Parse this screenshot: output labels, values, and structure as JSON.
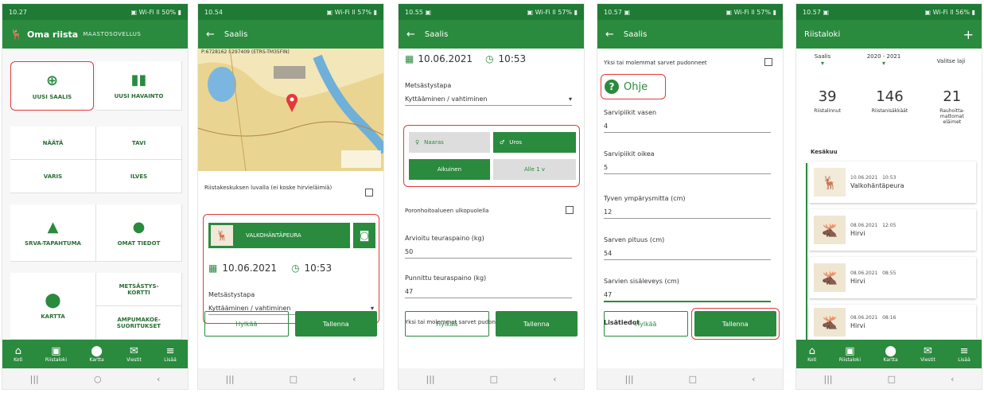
{
  "statusbar": {
    "p1": {
      "time": "10.27",
      "right": "▣ Wi-Fi ll 50% ▮"
    },
    "p2": {
      "time": "10.54",
      "right": "▣ Wi-Fi ll 57% ▮"
    },
    "p3": {
      "time": "10.55 ▣",
      "right": "▣ Wi-Fi ll 57% ▮"
    },
    "p4": {
      "time": "10.57 ▣",
      "right": "▣ Wi-Fi ll 57% ▮"
    },
    "p5": {
      "time": "10.57 ▣",
      "right": "▣ Wi-Fi ll 56% ▮"
    }
  },
  "home": {
    "brand": "Oma riista",
    "subtitle": "MAASTOSOVELLUS",
    "tiles": {
      "new_catch": "UUSI SAALIS",
      "new_observation": "UUSI HAVAINTO",
      "nayta": "NÄÄTÄ",
      "tavi": "TAVI",
      "varis": "VARIS",
      "ilves": "ILVES",
      "srva": "SRVA-TAPAHTUMA",
      "own_info": "OMAT TIEDOT",
      "license": "METSÄSTYS-KORTTI",
      "map": "KARTTA",
      "shooting": "AMPUMAKOE-SUORITUKSET"
    }
  },
  "nav": {
    "home": "Koti",
    "diary": "Riistaloki",
    "map": "Kartta",
    "messages": "Viestit",
    "more": "Lisää"
  },
  "catch_title": "Saalis",
  "p2": {
    "map_coords": "P:6728162 I:297409 (ETRS-TM35FIN)",
    "permit_check": "Riistakeskuksen luvalla (ei koske hirvieläimiä)",
    "species": "VALKOHÄNTÄPEURA",
    "date": "10.06.2021",
    "time": "10:53",
    "method_label": "Metsästystapa",
    "method_value": "Kyttääminen / vahtiminen",
    "reject": "Hylkää",
    "save": "Tallenna"
  },
  "p3": {
    "date": "10.06.2021",
    "time": "10:53",
    "method_label": "Metsästystapa",
    "method_value": "Kyttääminen / vahtiminen",
    "female": "Naaras",
    "male": "Uros",
    "adult": "Aikuinen",
    "young": "Alle 1 v",
    "non_edible": "Poronhoitoalueen ulkopuolella",
    "est_weight_label": "Arvioitu teuraspaino (kg)",
    "est_weight": "50",
    "measured_weight_label": "Punnittu teuraspaino (kg)",
    "measured_weight": "47",
    "antlers_lost": "Yksi tai molemmat sarvet pudonneet",
    "reject": "Hylkää",
    "save": "Tallenna"
  },
  "p4": {
    "antlers_lost": "Yksi tai molemmat sarvet pudonneet",
    "help": "Ohje",
    "left_points_label": "Sarvipiikit vasen",
    "left_points": "4",
    "right_points_label": "Sarvipiikit oikea",
    "right_points": "5",
    "circ_label": "Tyven ympärysmitta (cm)",
    "circ": "12",
    "length_label": "Sarven pituus (cm)",
    "length": "54",
    "width_label": "Sarvien sisäleveys (cm)",
    "width": "47",
    "extra_label": "Lisätiedot",
    "reject": "Hylkää",
    "save": "Tallenna"
  },
  "p5": {
    "title": "Riistaloki",
    "add": "+",
    "filter_type": "Saalis",
    "filter_season": "2020 - 2021",
    "filter_species": "Valitse laji",
    "stats": [
      {
        "value": "39",
        "label": "Riistalinnut"
      },
      {
        "value": "146",
        "label": "Riistanisäkkäät"
      },
      {
        "value": "21",
        "label": "Rauhoitta-mattomat eläimet"
      }
    ],
    "month": "Kesäkuu",
    "entries": [
      {
        "date": "10.06.2021",
        "time": "10:53",
        "species": "Valkohäntäpeura"
      },
      {
        "date": "08.06.2021",
        "time": "12:05",
        "species": "Hirvi"
      },
      {
        "date": "08.06.2021",
        "time": "08:55",
        "species": "Hirvi"
      },
      {
        "date": "08.06.2021",
        "time": "08:16",
        "species": "Hirvi"
      }
    ]
  },
  "colors": {
    "primary": "#2a8a3e",
    "status": "#1e7a34",
    "highlight": "#e23a3a"
  }
}
